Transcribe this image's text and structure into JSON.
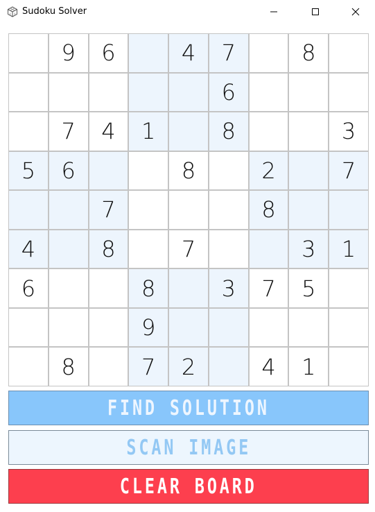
{
  "window": {
    "title": "Sudoku Solver",
    "controls": [
      "minimize",
      "maximize",
      "close"
    ]
  },
  "board": {
    "rows": [
      [
        "",
        "9",
        "6",
        "",
        "4",
        "7",
        "",
        "8",
        ""
      ],
      [
        "",
        "",
        "",
        "",
        "",
        "6",
        "",
        "",
        ""
      ],
      [
        "",
        "7",
        "4",
        "1",
        "",
        "8",
        "",
        "",
        "3"
      ],
      [
        "5",
        "6",
        "",
        "",
        "8",
        "",
        "2",
        "",
        "7"
      ],
      [
        "",
        "",
        "7",
        "",
        "",
        "",
        "8",
        "",
        ""
      ],
      [
        "4",
        "",
        "8",
        "",
        "7",
        "",
        "",
        "3",
        "1"
      ],
      [
        "6",
        "",
        "",
        "8",
        "",
        "3",
        "7",
        "5",
        ""
      ],
      [
        "",
        "",
        "",
        "9",
        "",
        "",
        "",
        "",
        ""
      ],
      [
        "",
        "8",
        "",
        "7",
        "2",
        "",
        "4",
        "1",
        ""
      ]
    ]
  },
  "buttons": {
    "find_label": "FIND SOLUTION",
    "scan_label": "SCAN IMAGE",
    "clear_label": "CLEAR BOARD"
  },
  "colors": {
    "highlight": "#edf5fd",
    "find": "#88c6fb",
    "scan": "#edf6fe",
    "clear": "#fd3f4e"
  }
}
